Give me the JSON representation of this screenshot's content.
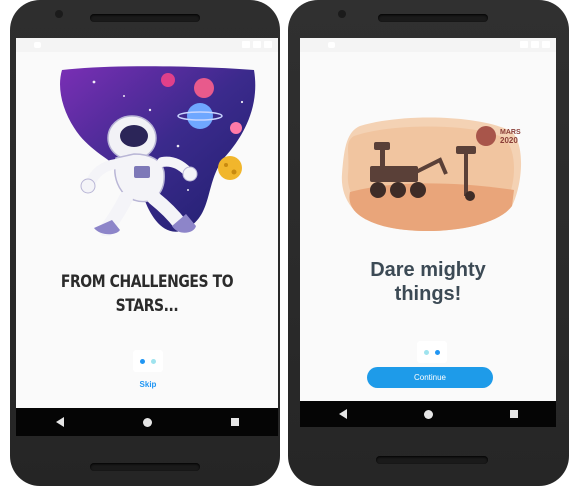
{
  "screens": [
    {
      "headline_line1": "FROM CHALLENGES TO",
      "headline_line2": "STARS...",
      "action_label": "Skip",
      "active_dot": 0
    },
    {
      "headline_line1": "Dare mighty",
      "headline_line2": "things!",
      "action_label": "Continue",
      "logo_line1": "MARS",
      "logo_line2": "2020",
      "active_dot": 1
    }
  ],
  "colors": {
    "accent": "#1e9be9",
    "dot_active": "#2196f3",
    "dot_inactive": "#9fe3ee",
    "space_purple": "#3b2a8c",
    "mars_sand": "#f1c9a4"
  },
  "icons": {
    "nav_back": "triangle-back-icon",
    "nav_home": "circle-home-icon",
    "nav_recent": "square-recent-icon"
  }
}
